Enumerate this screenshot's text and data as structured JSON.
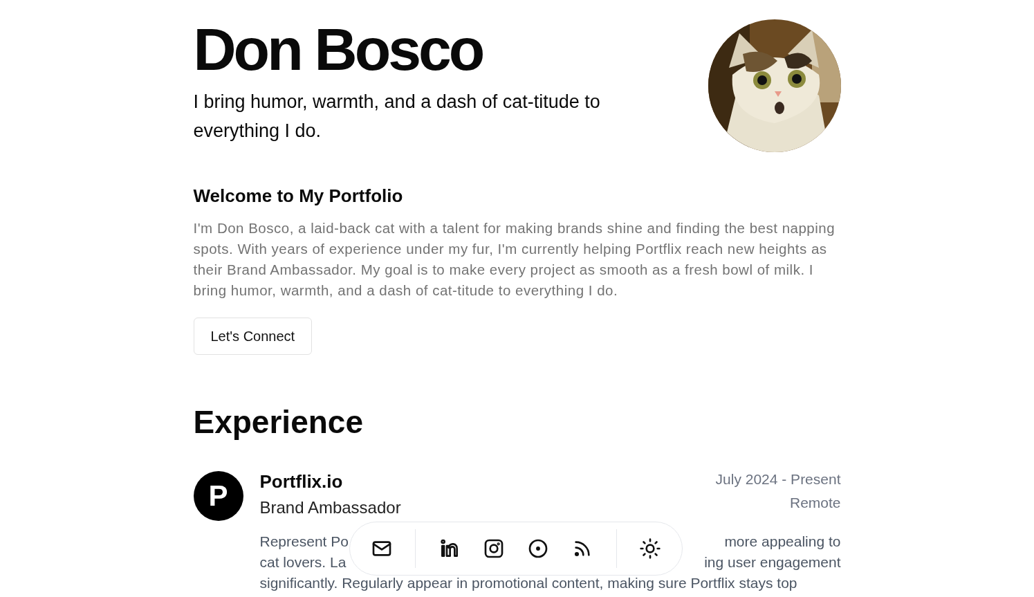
{
  "hero": {
    "name": "Don Bosco",
    "tagline": "I bring humor, warmth, and a dash of cat-titude to everything I do."
  },
  "about": {
    "heading": "Welcome to My Portfolio",
    "text": "I'm Don Bosco, a laid-back cat with a talent for making brands shine and finding the best napping spots. With years of experience under my fur, I'm currently helping Portflix reach new heights as their Brand Ambassador. My goal is to make every project as smooth as a fresh bowl of milk. I bring humor, warmth, and a dash of cat-titude to everything I do.",
    "button": "Let's Connect"
  },
  "experience": {
    "heading": "Experience",
    "items": [
      {
        "logo_letter": "P",
        "company": "Portflix.io",
        "role": "Brand Ambassador",
        "dates": "July 2024 - Present",
        "location": "Remote",
        "description_lines": [
          {
            "left": "Represent Po",
            "right": "more appealing to"
          },
          {
            "left": "cat lovers. La",
            "right": "ing user engagement"
          },
          {
            "left": "significantly. Regularly appear in promotional content, making sure Portflix stays top"
          }
        ]
      }
    ]
  },
  "dock": [
    {
      "kind": "mail"
    },
    {
      "kind": "divider"
    },
    {
      "kind": "linkedin"
    },
    {
      "kind": "instagram"
    },
    {
      "kind": "target"
    },
    {
      "kind": "rss"
    },
    {
      "kind": "divider"
    },
    {
      "kind": "theme"
    }
  ]
}
